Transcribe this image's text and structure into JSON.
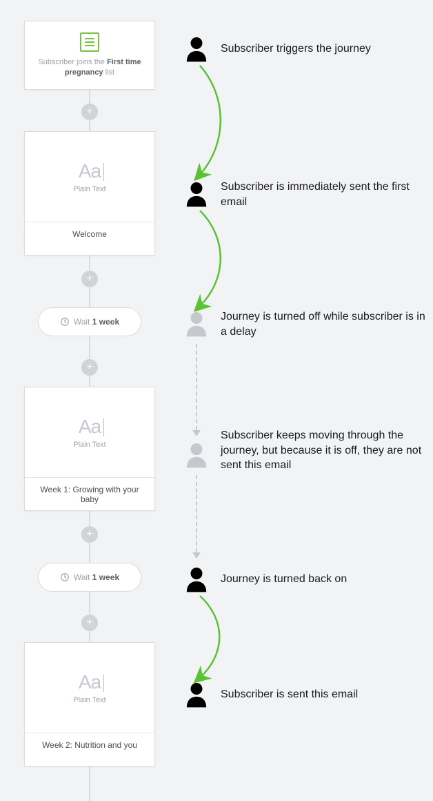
{
  "trigger": {
    "prefix": "Subscriber joins the ",
    "listName": "First time pregnancy",
    "suffix": " list"
  },
  "emails": [
    {
      "typeLabel": "Plain Text",
      "title": "Welcome"
    },
    {
      "typeLabel": "Plain Text",
      "title": "Week 1: Growing with your baby"
    },
    {
      "typeLabel": "Plain Text",
      "title": "Week 2: Nutrition and you"
    }
  ],
  "waits": [
    {
      "prefix": "Wait ",
      "duration": "1 week"
    },
    {
      "prefix": "Wait ",
      "duration": "1 week"
    }
  ],
  "annotations": [
    {
      "text": "Subscriber triggers the journey",
      "active": true
    },
    {
      "text": "Subscriber is immediately sent the first email",
      "active": true
    },
    {
      "text": "Journey is turned off while subscriber is in a delay",
      "active": false
    },
    {
      "text": "Subscriber keeps moving through the journey, but because it is off, they are not sent this email",
      "active": false
    },
    {
      "text": "Journey is turned back on",
      "active": true
    },
    {
      "text": "Subscriber is sent this email",
      "active": true
    }
  ],
  "colors": {
    "activePerson": "#000000",
    "inactivePerson": "#c4c9cf",
    "arrowGreen": "#5bc236",
    "accentGreen": "#7ac142"
  },
  "glyphs": {
    "plus": "+",
    "aa": "Aa"
  }
}
